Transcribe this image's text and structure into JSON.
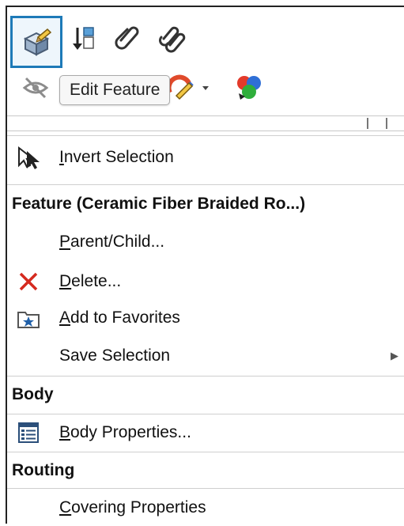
{
  "toolbar": {
    "icons": [
      {
        "name": "edit-feature-icon",
        "selected": true
      },
      {
        "name": "rollback-icon"
      },
      {
        "name": "paperclip-icon"
      },
      {
        "name": "paperclips-icon"
      },
      {
        "name": "hide-eye-icon"
      },
      {
        "name": "appearance-icon"
      },
      {
        "name": "color-palette-icon"
      }
    ],
    "tooltip": "Edit Feature"
  },
  "menu": {
    "invert_selection": "Invert Selection",
    "feature_header": "Feature (Ceramic Fiber Braided Ro...)",
    "parent_child": "Parent/Child...",
    "delete": "Delete...",
    "add_to_favorites": "Add to Favorites",
    "save_selection": "Save Selection",
    "body_header": "Body",
    "body_properties": "Body Properties...",
    "routing_header": "Routing",
    "covering_properties": "Covering Properties"
  },
  "colors": {
    "selected_border": "#1e7ab8",
    "delete_x": "#d52a1f"
  }
}
